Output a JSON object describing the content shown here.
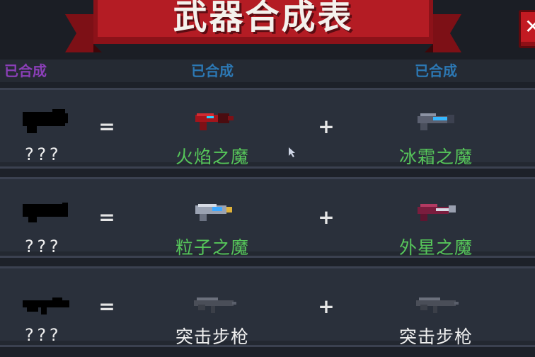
{
  "header": {
    "title": "武器合成表",
    "close_icon": "close-x-icon",
    "banner_color": "#b41c24"
  },
  "previous_row": {
    "result_label": "已合成",
    "left_ingredient": "已合成",
    "right_ingredient": "已合成"
  },
  "operators": {
    "equals": "=",
    "plus": "+"
  },
  "recipes": [
    {
      "result": {
        "name": "???",
        "icon": "unknown-weapon-silhouette-icon"
      },
      "left": {
        "name": "火焰之魔",
        "icon": "red-blaster-icon",
        "color": "#56c65a"
      },
      "right": {
        "name": "冰霜之魔",
        "icon": "ice-blaster-icon",
        "color": "#56c65a"
      }
    },
    {
      "result": {
        "name": "???",
        "icon": "unknown-weapon-silhouette-icon"
      },
      "left": {
        "name": "粒子之魔",
        "icon": "particle-blaster-icon",
        "color": "#56c65a"
      },
      "right": {
        "name": "外星之魔",
        "icon": "alien-blaster-icon",
        "color": "#56c65a"
      }
    },
    {
      "result": {
        "name": "???",
        "icon": "unknown-rifle-silhouette-icon"
      },
      "left": {
        "name": "突击步枪",
        "icon": "assault-rifle-icon",
        "color": "#eeeeee"
      },
      "right": {
        "name": "突击步枪",
        "icon": "assault-rifle-icon",
        "color": "#eeeeee"
      }
    }
  ]
}
